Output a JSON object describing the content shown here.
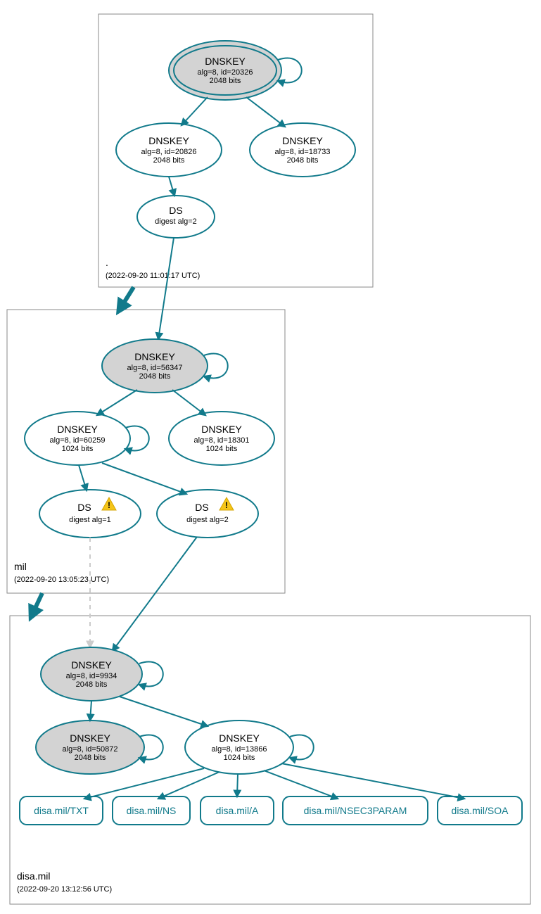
{
  "colors": {
    "stroke": "#117a8b",
    "ksk_fill": "#d3d3d3"
  },
  "zones": {
    "root": {
      "label": ".",
      "ts": "(2022-09-20 11:01:17 UTC)"
    },
    "mil": {
      "label": "mil",
      "ts": "(2022-09-20 13:05:23 UTC)"
    },
    "disa": {
      "label": "disa.mil",
      "ts": "(2022-09-20 13:12:56 UTC)"
    }
  },
  "nodes": {
    "root_ksk": {
      "title": "DNSKEY",
      "l1": "alg=8, id=20326",
      "l2": "2048 bits"
    },
    "root_zsk1": {
      "title": "DNSKEY",
      "l1": "alg=8, id=20826",
      "l2": "2048 bits"
    },
    "root_zsk2": {
      "title": "DNSKEY",
      "l1": "alg=8, id=18733",
      "l2": "2048 bits"
    },
    "root_ds": {
      "title": "DS",
      "l1": "digest alg=2",
      "l2": ""
    },
    "mil_ksk": {
      "title": "DNSKEY",
      "l1": "alg=8, id=56347",
      "l2": "2048 bits"
    },
    "mil_zsk1": {
      "title": "DNSKEY",
      "l1": "alg=8, id=60259",
      "l2": "1024 bits"
    },
    "mil_zsk2": {
      "title": "DNSKEY",
      "l1": "alg=8, id=18301",
      "l2": "1024 bits"
    },
    "mil_ds1": {
      "title": "DS",
      "l1": "digest alg=1",
      "l2": "",
      "warn": true
    },
    "mil_ds2": {
      "title": "DS",
      "l1": "digest alg=2",
      "l2": "",
      "warn": true
    },
    "disa_ksk": {
      "title": "DNSKEY",
      "l1": "alg=8, id=9934",
      "l2": "2048 bits"
    },
    "disa_zsk1": {
      "title": "DNSKEY",
      "l1": "alg=8, id=50872",
      "l2": "2048 bits"
    },
    "disa_zsk2": {
      "title": "DNSKEY",
      "l1": "alg=8, id=13866",
      "l2": "1024 bits"
    }
  },
  "rr": {
    "txt": "disa.mil/TXT",
    "ns": "disa.mil/NS",
    "a": "disa.mil/A",
    "nsec3": "disa.mil/NSEC3PARAM",
    "soa": "disa.mil/SOA"
  }
}
